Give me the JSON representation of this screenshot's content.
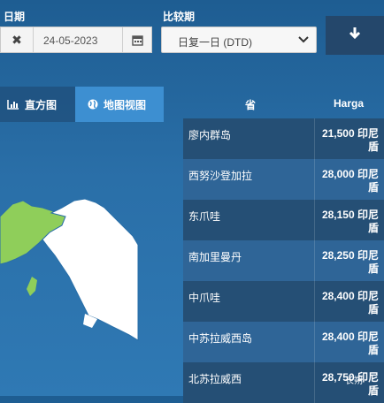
{
  "filters": {
    "date_label": "日期",
    "date_value": "24-05-2023",
    "compare_label": "比较期",
    "compare_value": "日复一日 (DTD)"
  },
  "tabs": [
    {
      "label": "直方图"
    },
    {
      "label": "地图视图"
    }
  ],
  "table": {
    "headers": {
      "province": "省",
      "price": "Harga"
    },
    "rows": [
      {
        "province": "廖内群岛",
        "price": "21,500 印尼盾"
      },
      {
        "province": "西努沙登加拉",
        "price": "28,000 印尼盾"
      },
      {
        "province": "东爪哇",
        "price": "28,150 印尼盾"
      },
      {
        "province": "南加里曼丹",
        "price": "28,250 印尼盾"
      },
      {
        "province": "中爪哇",
        "price": "28,400 印尼盾"
      },
      {
        "province": "中苏拉威西岛",
        "price": "28,400 印尼盾"
      },
      {
        "province": "北苏拉威西",
        "price": "28,750 印尼盾"
      }
    ]
  },
  "watermark": "长朔",
  "colors": {
    "background": "#2a6fa8",
    "active_tab": "#3d8fd1",
    "row_dark": "#254f75",
    "row_light": "#2f6597",
    "map_green": "#8fce5a",
    "map_white": "#ffffff"
  },
  "icons": [
    "close-icon",
    "calendar-icon",
    "chevron-down-icon",
    "download-icon",
    "bar-chart-icon",
    "globe-icon"
  ]
}
